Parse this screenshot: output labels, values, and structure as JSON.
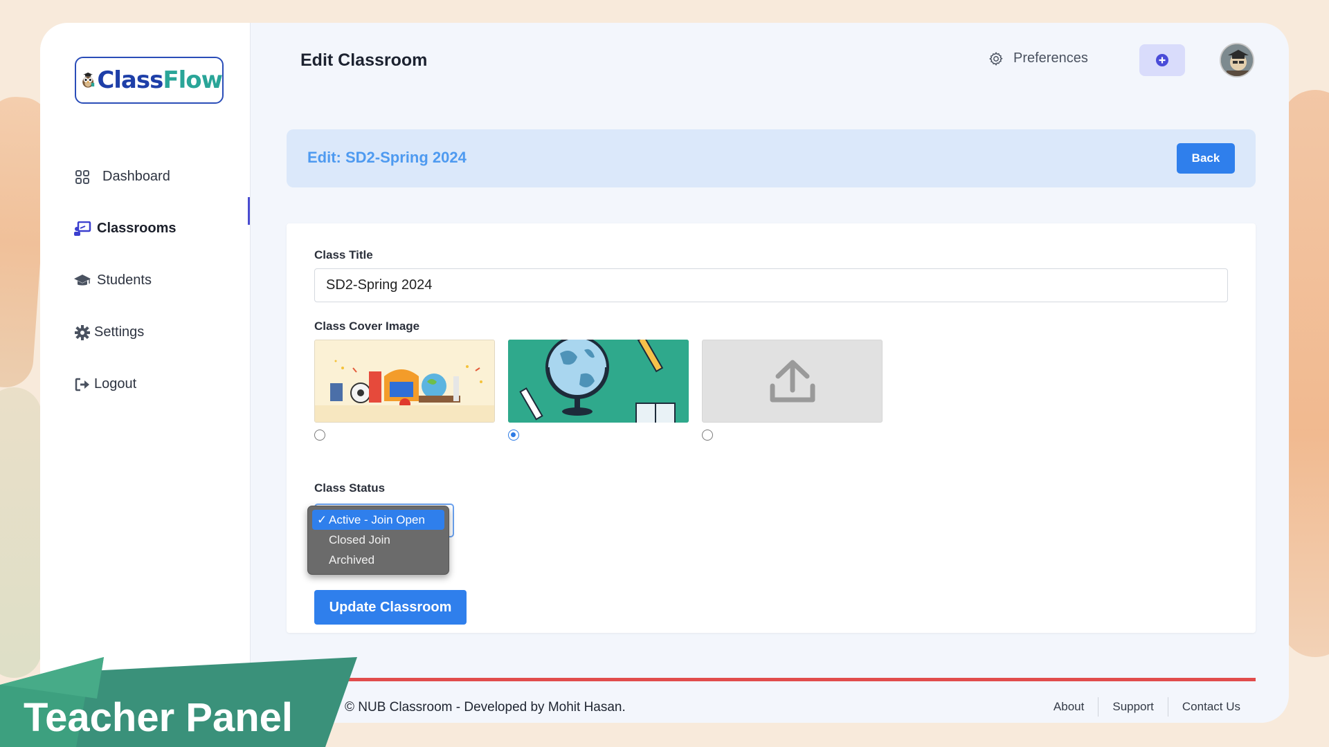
{
  "app": {
    "logo_text_1": "Class",
    "logo_text_2": "Flow"
  },
  "sidebar": {
    "items": [
      {
        "label": "Dashboard",
        "icon": "grid-icon"
      },
      {
        "label": "Classrooms",
        "icon": "classroom-icon",
        "active": true
      },
      {
        "label": "Students",
        "icon": "graduation-cap-icon"
      },
      {
        "label": "Settings",
        "icon": "gear-icon"
      },
      {
        "label": "Logout",
        "icon": "logout-icon"
      }
    ]
  },
  "header": {
    "title": "Edit Classroom",
    "preferences_label": "Preferences"
  },
  "banner": {
    "title": "Edit: SD2-Spring 2024",
    "back_label": "Back"
  },
  "form": {
    "class_title_label": "Class Title",
    "class_title_value": "SD2-Spring 2024",
    "cover_label": "Class Cover Image",
    "cover_options": [
      "school-supplies-cover",
      "globe-cover",
      "upload-cover"
    ],
    "cover_selected_index": 1,
    "status_label": "Class Status",
    "status_options": [
      "Active - Join Open",
      "Closed Join",
      "Archived"
    ],
    "status_selected": "Active - Join Open",
    "status_check": "✓",
    "submit_label": "Update Classroom"
  },
  "footer": {
    "copyright": "© NUB Classroom - Developed by Mohit Hasan.",
    "links": [
      "About",
      "Support",
      "Contact Us"
    ]
  },
  "overlay": {
    "teacher_panel": "Teacher Panel"
  },
  "colors": {
    "accent": "#2f7fec",
    "banner_bg": "#dbe8fa",
    "banner_text": "#4e9af0",
    "footer_line": "#e14c4c",
    "panel_green": "#3a9a7c"
  }
}
